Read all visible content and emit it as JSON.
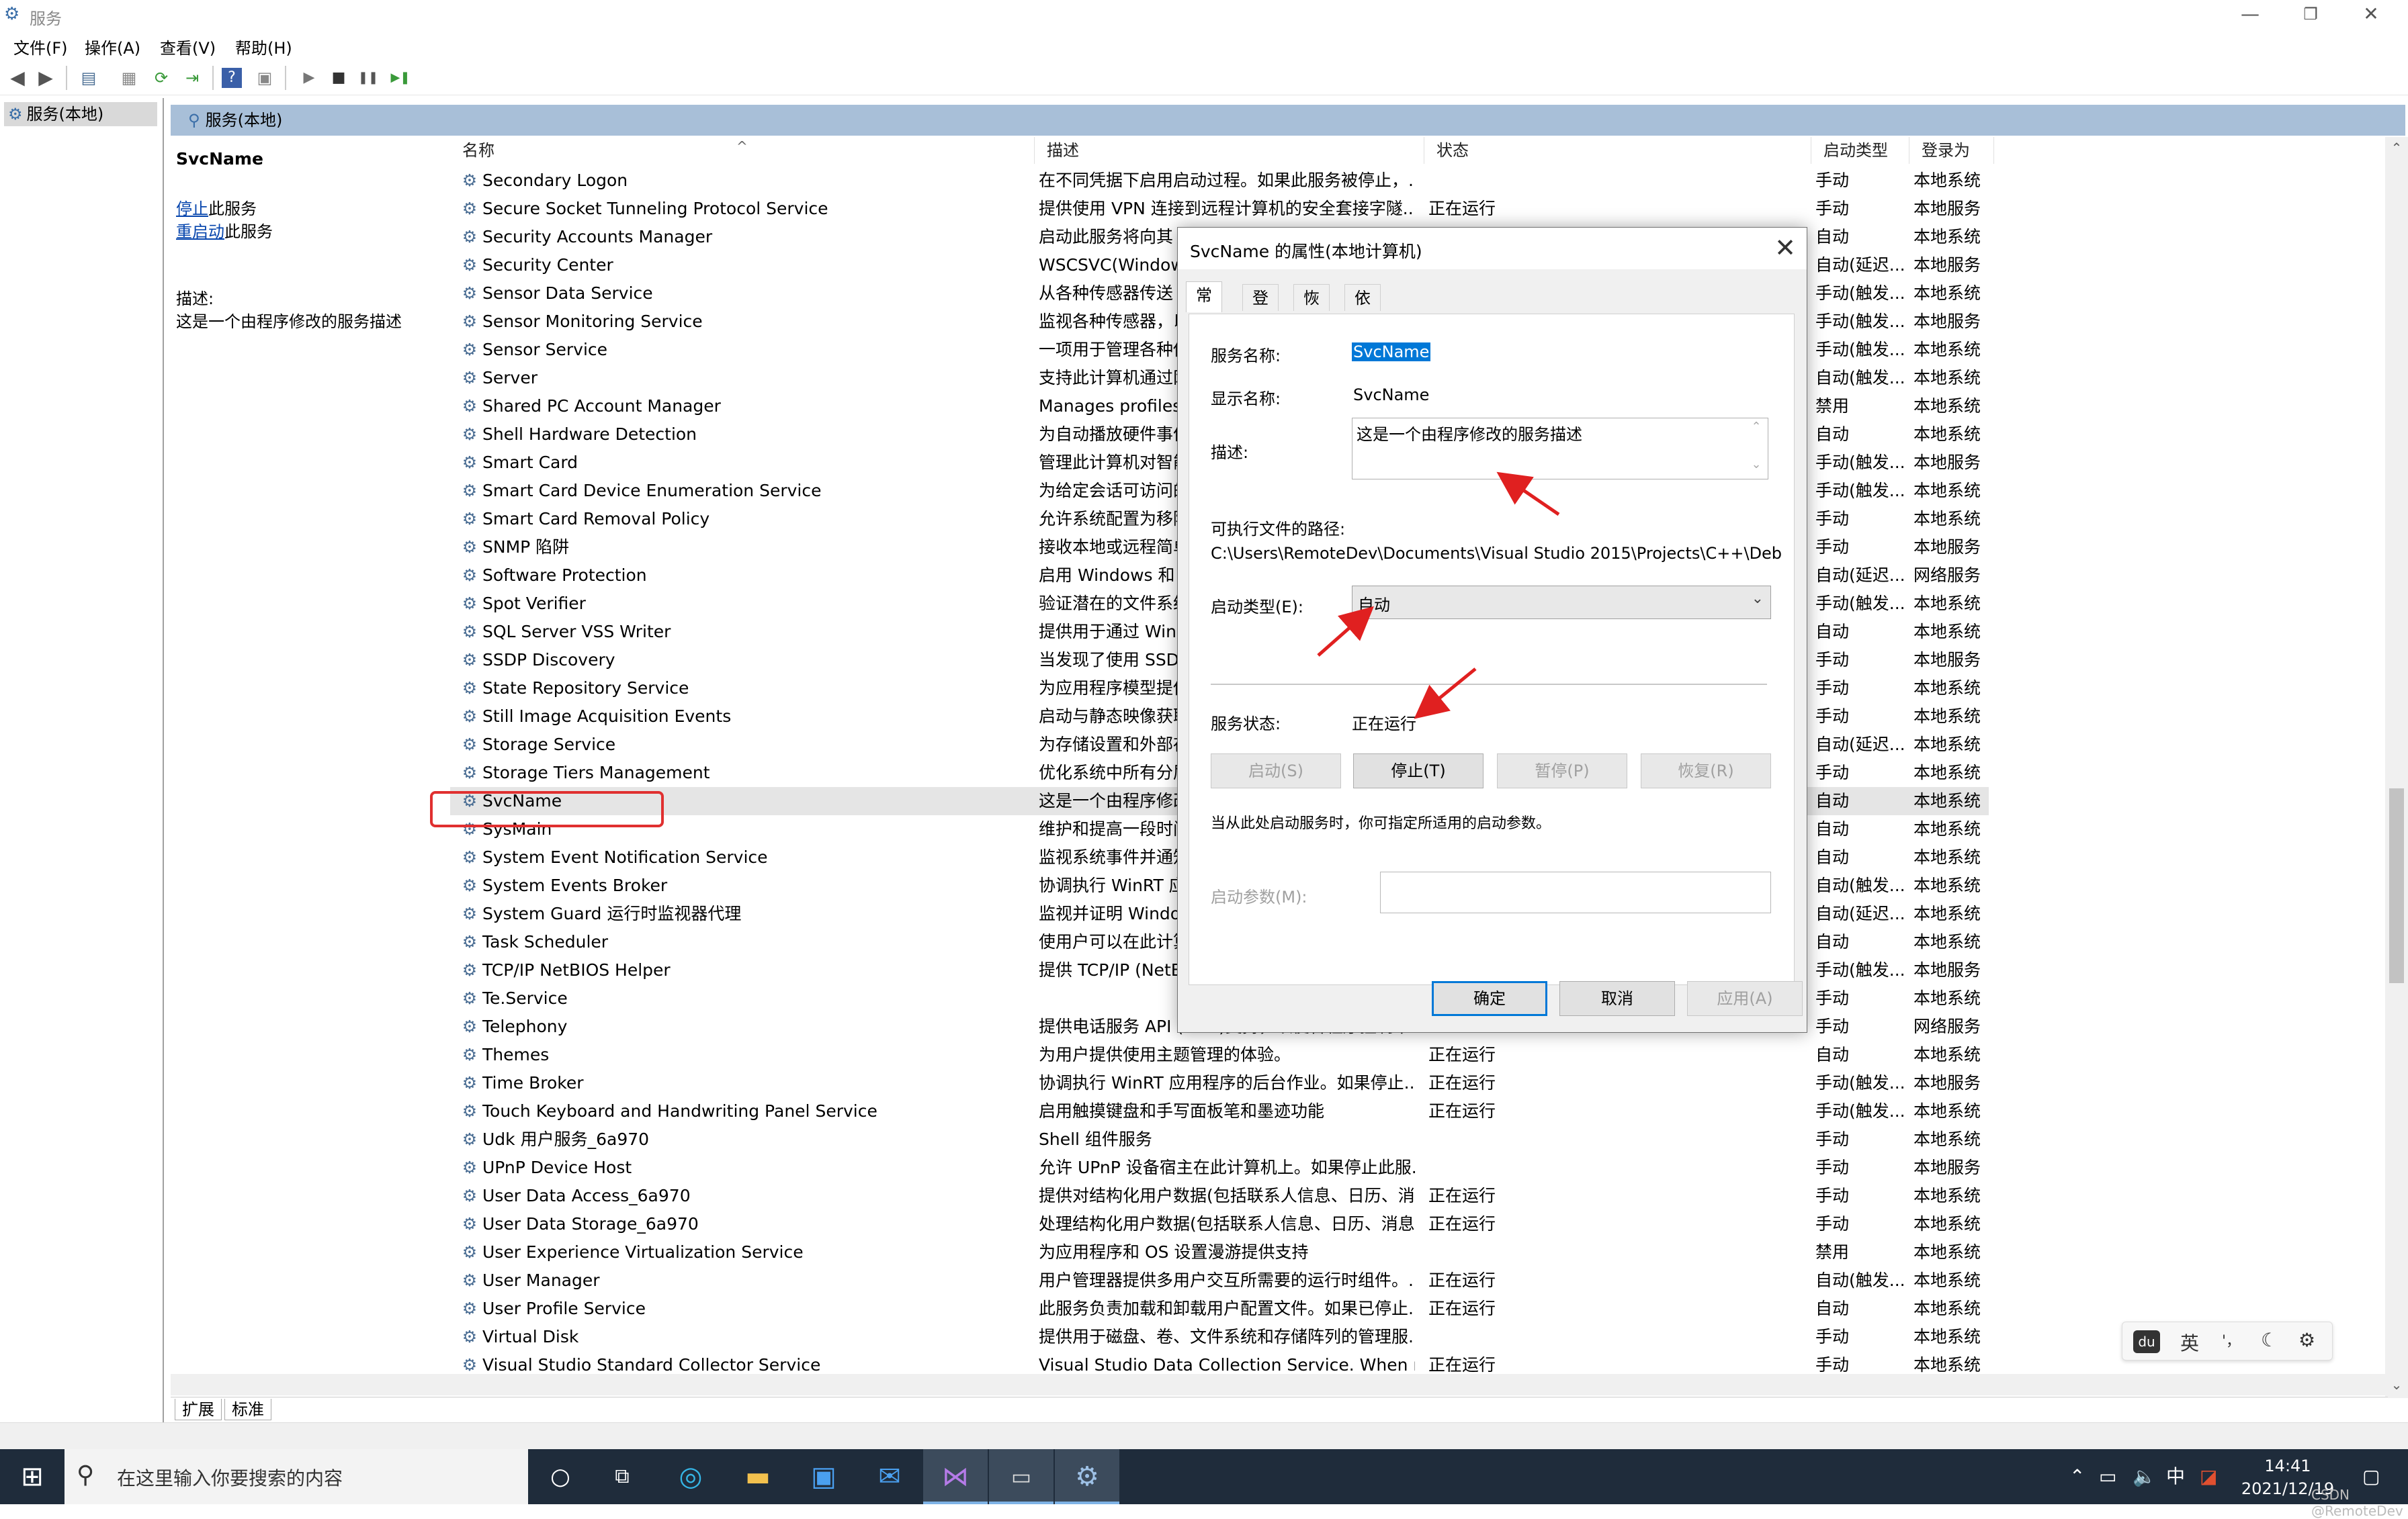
{
  "window": {
    "title": "服务",
    "min": "—",
    "restore": "❐",
    "close": "✕"
  },
  "menu": [
    "文件(F)",
    "操作(A)",
    "查看(V)",
    "帮助(H)"
  ],
  "toolbar": {
    "back": "◀",
    "forward": "▶",
    "play": "▶",
    "stop": "■",
    "pause": "❚❚",
    "resume": "▶❚"
  },
  "tree": {
    "root": "服务(本地)"
  },
  "header": {
    "tab": "服务(本地)"
  },
  "info": {
    "name": "SvcName",
    "stop_link": "停止",
    "stop_suffix": "此服务",
    "restart_link": "重启动",
    "restart_suffix": "此服务",
    "desc_label": "描述:",
    "desc_text": "这是一个由程序修改的服务描述"
  },
  "columns": {
    "name": "名称",
    "desc": "描述",
    "status": "状态",
    "startup": "启动类型",
    "logon": "登录为"
  },
  "services": [
    {
      "name": "Secondary Logon",
      "desc": "在不同凭据下启用启动过程。如果此服务被停止，...",
      "status": "",
      "startup": "手动",
      "logon": "本地系统"
    },
    {
      "name": "Secure Socket Tunneling Protocol Service",
      "desc": "提供使用 VPN 连接到远程计算机的安全套接字隧...",
      "status": "正在运行",
      "startup": "手动",
      "logon": "本地服务"
    },
    {
      "name": "Security Accounts Manager",
      "desc": "启动此服务将向其",
      "status": "",
      "startup": "自动",
      "logon": "本地系统"
    },
    {
      "name": "Security Center",
      "desc": "WSCSVC(Windows",
      "status": "",
      "startup": "自动(延迟...",
      "logon": "本地服务"
    },
    {
      "name": "Sensor Data Service",
      "desc": "从各种传感器传送",
      "status": "",
      "startup": "手动(触发...",
      "logon": "本地系统"
    },
    {
      "name": "Sensor Monitoring Service",
      "desc": "监视各种传感器，以",
      "status": "",
      "startup": "手动(触发...",
      "logon": "本地服务"
    },
    {
      "name": "Sensor Service",
      "desc": "一项用于管理各种传",
      "status": "",
      "startup": "手动(触发...",
      "logon": "本地系统"
    },
    {
      "name": "Server",
      "desc": "支持此计算机通过网",
      "status": "",
      "startup": "自动(触发...",
      "logon": "本地系统"
    },
    {
      "name": "Shared PC Account Manager",
      "desc": "Manages profiles",
      "status": "",
      "startup": "禁用",
      "logon": "本地系统"
    },
    {
      "name": "Shell Hardware Detection",
      "desc": "为自动播放硬件事件",
      "status": "",
      "startup": "自动",
      "logon": "本地系统"
    },
    {
      "name": "Smart Card",
      "desc": "管理此计算机对智能",
      "status": "",
      "startup": "手动(触发...",
      "logon": "本地服务"
    },
    {
      "name": "Smart Card Device Enumeration Service",
      "desc": "为给定会话可访问的",
      "status": "",
      "startup": "手动(触发...",
      "logon": "本地系统"
    },
    {
      "name": "Smart Card Removal Policy",
      "desc": "允许系统配置为移除",
      "status": "",
      "startup": "手动",
      "logon": "本地系统"
    },
    {
      "name": "SNMP 陷阱",
      "desc": "接收本地或远程简单",
      "status": "",
      "startup": "手动",
      "logon": "本地服务"
    },
    {
      "name": "Software Protection",
      "desc": "启用 Windows 和 W",
      "status": "",
      "startup": "自动(延迟...",
      "logon": "网络服务"
    },
    {
      "name": "Spot Verifier",
      "desc": "验证潜在的文件系统",
      "status": "",
      "startup": "手动(触发...",
      "logon": "本地系统"
    },
    {
      "name": "SQL Server VSS Writer",
      "desc": "提供用于通过 Windo",
      "status": "",
      "startup": "自动",
      "logon": "本地系统"
    },
    {
      "name": "SSDP Discovery",
      "desc": "当发现了使用 SSDP",
      "status": "",
      "startup": "手动",
      "logon": "本地服务"
    },
    {
      "name": "State Repository Service",
      "desc": "为应用程序模型提供",
      "status": "",
      "startup": "手动",
      "logon": "本地系统"
    },
    {
      "name": "Still Image Acquisition Events",
      "desc": "启动与静态映像获取",
      "status": "",
      "startup": "手动",
      "logon": "本地系统"
    },
    {
      "name": "Storage Service",
      "desc": "为存储设置和外部存",
      "status": "",
      "startup": "自动(延迟...",
      "logon": "本地系统"
    },
    {
      "name": "Storage Tiers Management",
      "desc": "优化系统中所有分层",
      "status": "",
      "startup": "手动",
      "logon": "本地系统"
    },
    {
      "name": "SvcName",
      "desc": "这是一个由程序修改",
      "status": "",
      "startup": "自动",
      "logon": "本地系统"
    },
    {
      "name": "SysMain",
      "desc": "维护和提高一段时间",
      "status": "",
      "startup": "自动",
      "logon": "本地系统"
    },
    {
      "name": "System Event Notification Service",
      "desc": "监视系统事件并通知",
      "status": "",
      "startup": "自动",
      "logon": "本地系统"
    },
    {
      "name": "System Events Broker",
      "desc": "协调执行 WinRT 应",
      "status": "",
      "startup": "自动(触发...",
      "logon": "本地系统"
    },
    {
      "name": "System Guard 运行时监视器代理",
      "desc": "监视并证明 Windo",
      "status": "",
      "startup": "自动(延迟...",
      "logon": "本地系统"
    },
    {
      "name": "Task Scheduler",
      "desc": "使用户可以在此计算",
      "status": "",
      "startup": "自动",
      "logon": "本地系统"
    },
    {
      "name": "TCP/IP NetBIOS Helper",
      "desc": "提供 TCP/IP (NetB",
      "status": "",
      "startup": "手动(触发...",
      "logon": "本地服务"
    },
    {
      "name": "Te.Service",
      "desc": "",
      "status": "",
      "startup": "手动",
      "logon": "本地系统"
    },
    {
      "name": "Telephony",
      "desc": "提供电话服务 API (TAPI)支持，以便各程序控制本...",
      "status": "",
      "startup": "手动",
      "logon": "网络服务"
    },
    {
      "name": "Themes",
      "desc": "为用户提供使用主题管理的体验。",
      "status": "正在运行",
      "startup": "自动",
      "logon": "本地系统"
    },
    {
      "name": "Time Broker",
      "desc": "协调执行 WinRT 应用程序的后台作业。如果停止...",
      "status": "正在运行",
      "startup": "手动(触发...",
      "logon": "本地服务"
    },
    {
      "name": "Touch Keyboard and Handwriting Panel Service",
      "desc": "启用触摸键盘和手写面板笔和墨迹功能",
      "status": "正在运行",
      "startup": "手动(触发...",
      "logon": "本地系统"
    },
    {
      "name": "Udk 用户服务_6a970",
      "desc": "Shell 组件服务",
      "status": "",
      "startup": "手动",
      "logon": "本地系统"
    },
    {
      "name": "UPnP Device Host",
      "desc": "允许 UPnP 设备宿主在此计算机上。如果停止此服...",
      "status": "",
      "startup": "手动",
      "logon": "本地服务"
    },
    {
      "name": "User Data Access_6a970",
      "desc": "提供对结构化用户数据(包括联系人信息、日历、消...",
      "status": "正在运行",
      "startup": "手动",
      "logon": "本地系统"
    },
    {
      "name": "User Data Storage_6a970",
      "desc": "处理结构化用户数据(包括联系人信息、日历、消息...",
      "status": "正在运行",
      "startup": "手动",
      "logon": "本地系统"
    },
    {
      "name": "User Experience Virtualization Service",
      "desc": "为应用程序和 OS 设置漫游提供支持",
      "status": "",
      "startup": "禁用",
      "logon": "本地系统"
    },
    {
      "name": "User Manager",
      "desc": "用户管理器提供多用户交互所需要的运行时组件。...",
      "status": "正在运行",
      "startup": "自动(触发...",
      "logon": "本地系统"
    },
    {
      "name": "User Profile Service",
      "desc": "此服务负责加载和卸载用户配置文件。如果已停止...",
      "status": "正在运行",
      "startup": "自动",
      "logon": "本地系统"
    },
    {
      "name": "Virtual Disk",
      "desc": "提供用于磁盘、卷、文件系统和存储阵列的管理服...",
      "status": "",
      "startup": "手动",
      "logon": "本地系统"
    },
    {
      "name": "Visual Studio Standard Collector Service",
      "desc": "Visual Studio Data Collection Service. When ru...",
      "status": "正在运行",
      "startup": "手动",
      "logon": "本地系统"
    }
  ],
  "bottom_tabs": [
    "扩展",
    "标准"
  ],
  "dialog": {
    "title": "SvcName 的属性(本地计算机)",
    "close": "✕",
    "tabs": [
      "常规",
      "登录",
      "恢复",
      "依存关系"
    ],
    "service_name_label": "服务名称:",
    "service_name_value": "SvcName",
    "display_name_label": "显示名称:",
    "display_name_value": "SvcName",
    "desc_label": "描述:",
    "desc_value": "这是一个由程序修改的服务描述",
    "exe_path_label": "可执行文件的路径:",
    "exe_path_value": "C:\\Users\\RemoteDev\\Documents\\Visual Studio 2015\\Projects\\C++\\Debu",
    "startup_type_label": "启动类型(E):",
    "startup_type_value": "自动",
    "status_label": "服务状态:",
    "status_value": "正在运行",
    "btn_start": "启动(S)",
    "btn_stop": "停止(T)",
    "btn_pause": "暂停(P)",
    "btn_resume": "恢复(R)",
    "hint": "当从此处启动服务时，你可指定所适用的启动参数。",
    "params_label": "启动参数(M):",
    "params_value": "",
    "ok": "确定",
    "cancel": "取消",
    "apply": "应用(A)"
  },
  "ime": {
    "logo": "du",
    "lang": "英",
    "punct": "'，",
    "moon": "☾",
    "gear": "⚙"
  },
  "taskbar": {
    "search_placeholder": "在这里输入你要搜索的内容",
    "time": "14:41",
    "date": "2021/12/19",
    "tray_ime": "中"
  },
  "watermark": "CSDN @RemoteDev",
  "colors": {
    "accent": "#0078d7",
    "highlight_border": "#e03030",
    "header_strip": "#a8bfd8"
  }
}
